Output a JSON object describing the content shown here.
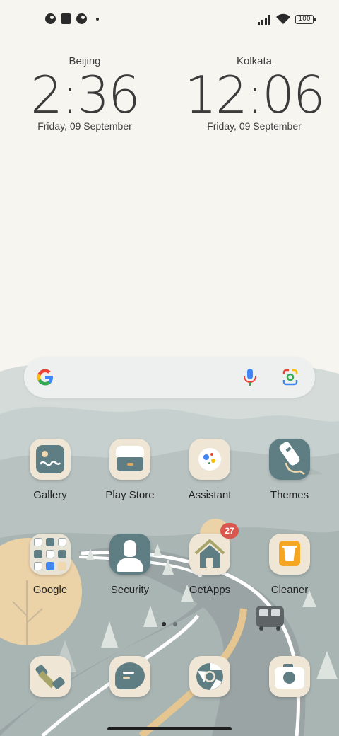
{
  "status_bar": {
    "battery": "100",
    "left_icons": [
      "notification-icon-1",
      "notification-icon-2",
      "notification-icon-3",
      "more-dot-icon"
    ],
    "right_icons": [
      "signal-icon",
      "wifi-icon",
      "battery-icon"
    ]
  },
  "clocks": [
    {
      "city": "Beijing",
      "time": "2:36",
      "date": "Friday, 09 September"
    },
    {
      "city": "Kolkata",
      "time": "12:06",
      "date": "Friday, 09 September"
    }
  ],
  "search": {
    "icons": [
      "google-g-icon",
      "microphone-icon",
      "lens-icon"
    ]
  },
  "apps": [
    {
      "label": "Gallery",
      "icon": "gallery-icon"
    },
    {
      "label": "Play Store",
      "icon": "play-store-icon"
    },
    {
      "label": "Assistant",
      "icon": "assistant-icon"
    },
    {
      "label": "Themes",
      "icon": "themes-icon"
    },
    {
      "label": "Google",
      "icon": "google-folder-icon"
    },
    {
      "label": "Security",
      "icon": "security-icon"
    },
    {
      "label": "GetApps",
      "icon": "getapps-icon",
      "badge": "27"
    },
    {
      "label": "Cleaner",
      "icon": "cleaner-icon"
    }
  ],
  "page_indicator": {
    "pages": 2,
    "current": 1
  },
  "dock": [
    {
      "icon": "phone-icon"
    },
    {
      "icon": "messages-icon"
    },
    {
      "icon": "browser-icon"
    },
    {
      "icon": "camera-icon"
    }
  ],
  "colors": {
    "background": "#f7f5f0",
    "hills": "#c9d3d0",
    "road": "#9aa4a4",
    "icon_bg": "#efe6d6",
    "icon_accent": "#5f7e84",
    "badge": "#d9574e"
  }
}
